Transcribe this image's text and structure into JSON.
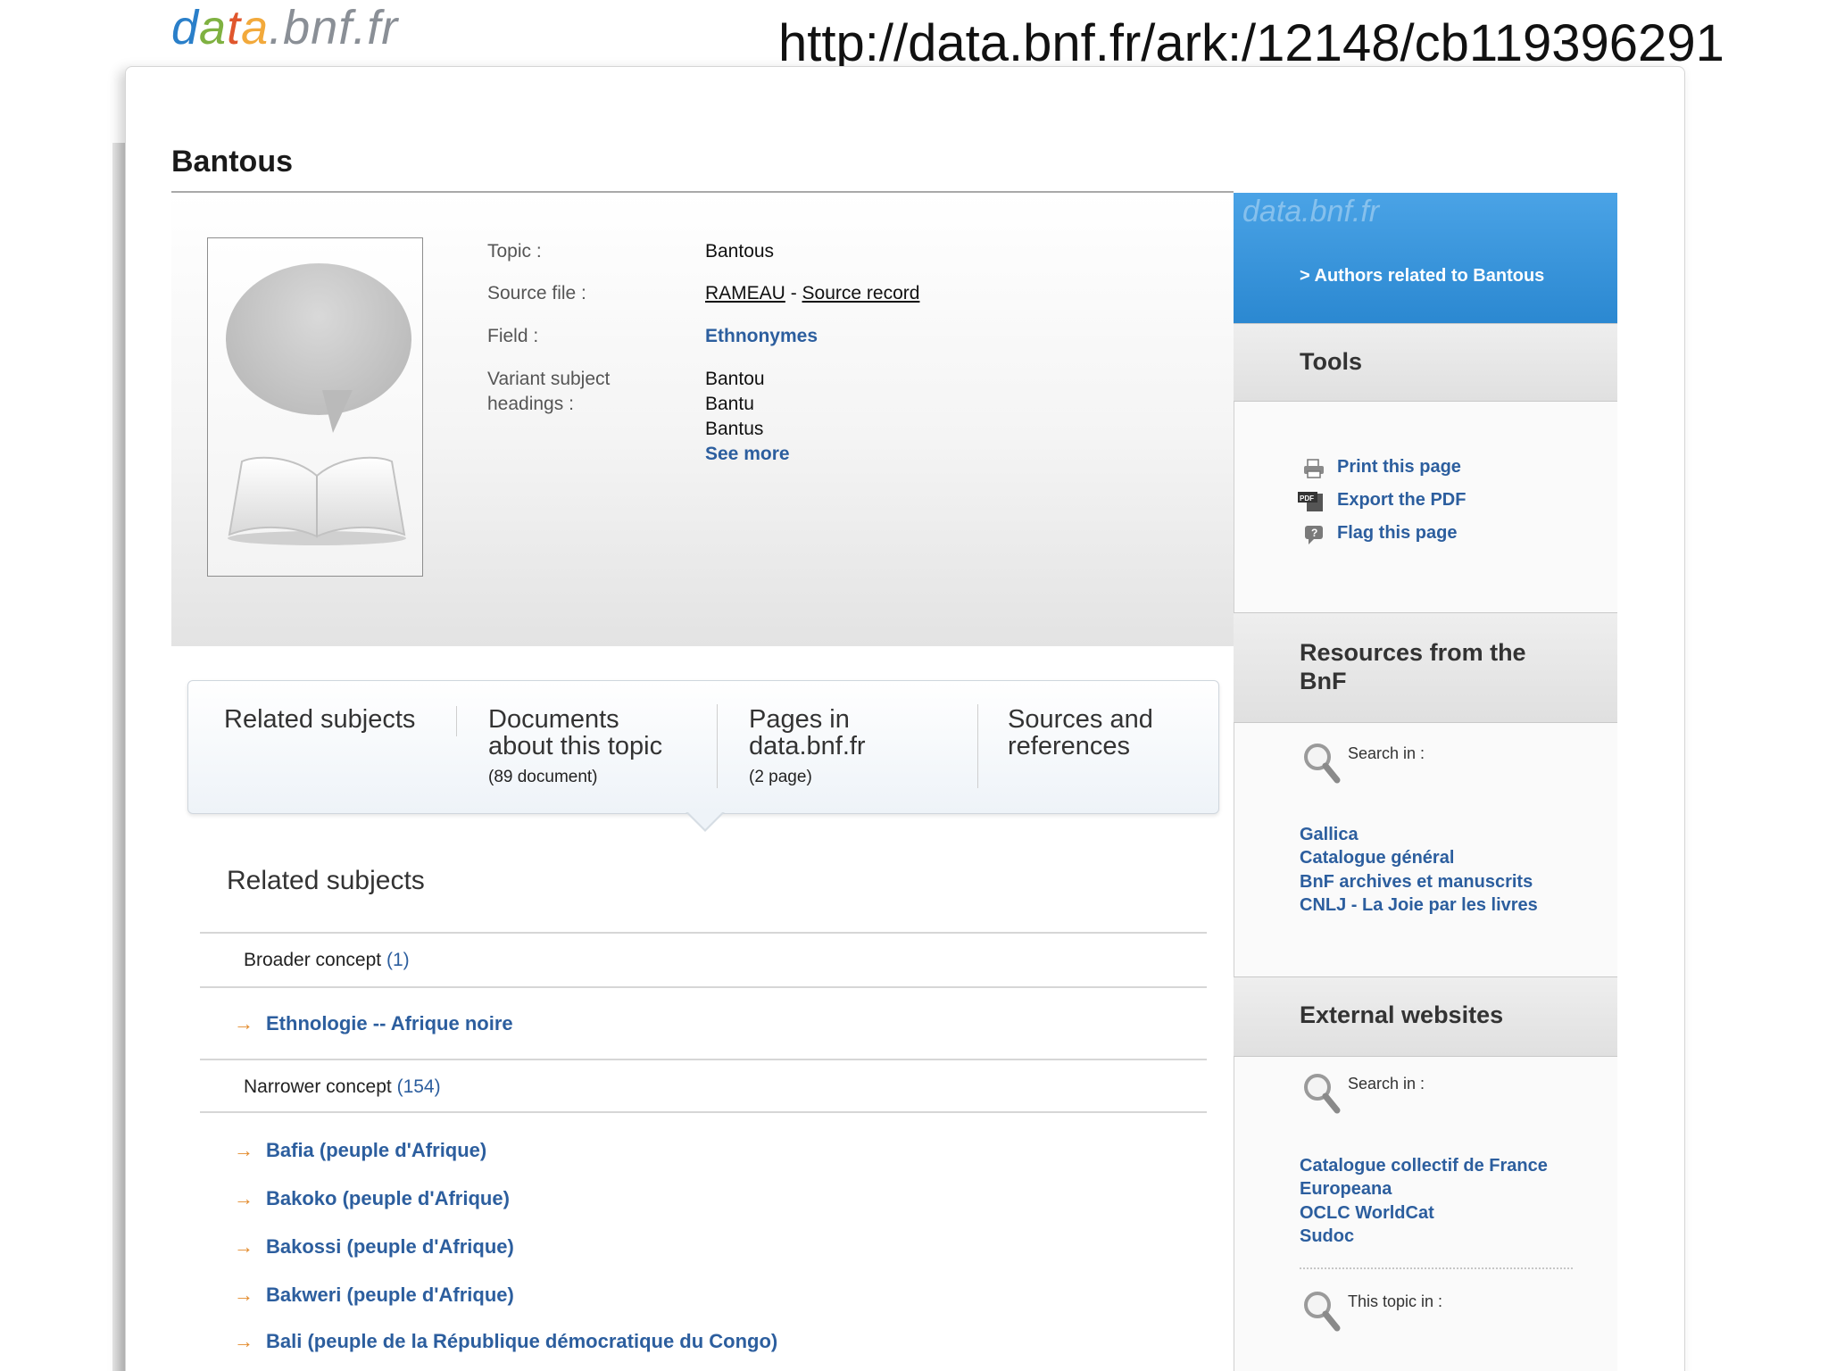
{
  "header": {
    "logo": {
      "d": "d",
      "a1": "a",
      "t": "t",
      "a2": "a",
      "rest": ".bnf.fr"
    },
    "url": "http://data.bnf.fr/ark:/12148/cb119396291"
  },
  "page": {
    "title": "Bantous"
  },
  "info": {
    "topic_label": "Topic :",
    "topic_value": "Bantous",
    "source_label": "Source file :",
    "source_rameau": "RAMEAU",
    "source_sep": " - ",
    "source_record": "Source record",
    "field_label": "Field :",
    "field_value": "Ethnonymes",
    "variant_label_1": "Variant subject",
    "variant_label_2": "headings :",
    "variants": [
      "Bantou",
      "Bantu",
      "Bantus"
    ],
    "see_more": "See more"
  },
  "tabs": [
    {
      "title_1": "Related subjects",
      "title_2": "",
      "sub": ""
    },
    {
      "title_1": "Documents",
      "title_2": "about this topic",
      "sub": "(89 document)"
    },
    {
      "title_1": "Pages in",
      "title_2": "data.bnf.fr",
      "sub": "(2 page)"
    },
    {
      "title_1": "Sources and",
      "title_2": "references",
      "sub": ""
    }
  ],
  "related": {
    "heading": "Related subjects",
    "broader_label": "Broader concept",
    "broader_count": "(1)",
    "broader_items": [
      "Ethnologie -- Afrique noire"
    ],
    "narrower_label": "Narrower concept",
    "narrower_count": "(154)",
    "narrower_items": [
      "Bafia (peuple d'Afrique)",
      "Bakoko (peuple d'Afrique)",
      "Bakossi (peuple d'Afrique)",
      "Bakweri (peuple d'Afrique)",
      "Bali (peuple de la République démocratique du Congo)"
    ]
  },
  "sidebar": {
    "blue_logo": "data.bnf.fr",
    "authors_link": "> Authors related to Bantous",
    "tools_heading": "Tools",
    "tools": [
      "Print this page",
      "Export the PDF",
      "Flag this page"
    ],
    "pdf_icon_text": "PDF",
    "resources_heading_1": "Resources from the",
    "resources_heading_2": "BnF",
    "search_in": "Search in :",
    "resources_links": [
      "Gallica",
      "Catalogue général",
      "BnF archives et manuscrits",
      "CNLJ - La Joie par les livres"
    ],
    "external_heading": "External websites",
    "external_search_in": "Search in :",
    "external_links": [
      "Catalogue collectif de France",
      "Europeana",
      "OCLC WorldCat",
      "Sudoc"
    ],
    "topic_in": "This topic in :"
  },
  "colors": {
    "link_blue": "#2c5e9e",
    "accent_blue": "#2b88d1",
    "arrow_orange": "#e38b2d"
  },
  "icons": [
    "print-icon",
    "pdf-icon",
    "flag-icon",
    "search-icon"
  ]
}
